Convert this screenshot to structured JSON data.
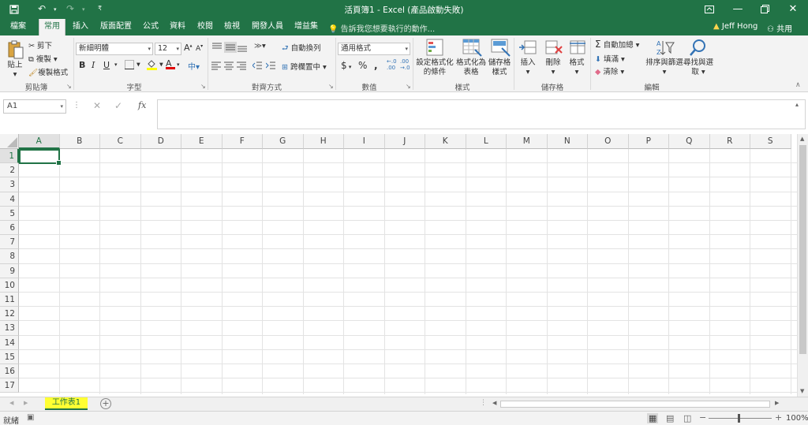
{
  "titlebar": {
    "title": "活頁簿1 - Excel (產品啟動失敗)",
    "restore_ribbon_icon": "ribbon-display-icon"
  },
  "tabs": [
    {
      "label": "檔案"
    },
    {
      "label": "常用"
    },
    {
      "label": "插入"
    },
    {
      "label": "版面配置"
    },
    {
      "label": "公式"
    },
    {
      "label": "資料"
    },
    {
      "label": "校閱"
    },
    {
      "label": "檢視"
    },
    {
      "label": "開發人員"
    },
    {
      "label": "增益集"
    }
  ],
  "tell_me": "告訴我您想要執行的動作...",
  "user": "Jeff Hong",
  "share": "共用",
  "ribbon": {
    "clipboard": {
      "paste": "貼上",
      "cut": "剪下",
      "copy": "複製",
      "format_painter": "複製格式",
      "label": "剪貼簿"
    },
    "font": {
      "name": "新細明體",
      "size": "12",
      "label": "字型",
      "bold": "B",
      "italic": "I",
      "underline": "U"
    },
    "alignment": {
      "wrap": "自動換列",
      "merge": "跨欄置中",
      "label": "對齊方式"
    },
    "number": {
      "format": "通用格式",
      "label": "數值",
      "currency": "$",
      "percent": "%",
      "comma": ","
    },
    "styles": {
      "conditional": "設定格式化的條件",
      "as_table": "格式化為表格",
      "cell_styles": "儲存格樣式",
      "label": "樣式"
    },
    "cells": {
      "insert": "插入",
      "delete": "刪除",
      "format": "格式",
      "label": "儲存格"
    },
    "editing": {
      "autosum": "自動加總",
      "fill": "填滿",
      "clear": "清除",
      "sort": "排序與篩選",
      "find": "尋找與選取",
      "label": "編輯"
    }
  },
  "formula_bar": {
    "name_box": "A1",
    "fx": "fx",
    "value": ""
  },
  "grid": {
    "columns": [
      "A",
      "B",
      "C",
      "D",
      "E",
      "F",
      "G",
      "H",
      "I",
      "J",
      "K",
      "L",
      "M",
      "N",
      "O",
      "P",
      "Q",
      "R",
      "S"
    ],
    "rows": [
      "1",
      "2",
      "3",
      "4",
      "5",
      "6",
      "7",
      "8",
      "9",
      "10",
      "11",
      "12",
      "13",
      "14",
      "15",
      "16",
      "17"
    ],
    "selected": "A1"
  },
  "sheets": [
    {
      "label": "工作表1"
    }
  ],
  "status": {
    "text": "就緒",
    "zoom": "100%"
  },
  "colors": {
    "accent": "#217346",
    "tab_highlight": "#ffff33"
  }
}
